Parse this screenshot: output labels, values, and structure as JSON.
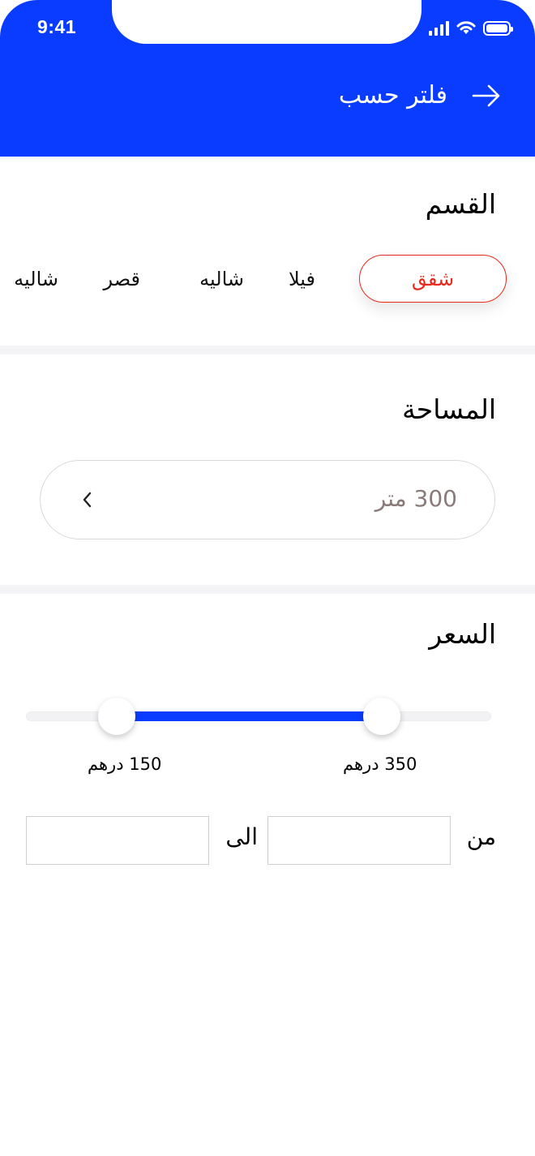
{
  "status_bar": {
    "time": "9:41"
  },
  "header": {
    "title": "فلتر حسب",
    "back_icon": "arrow-right-icon"
  },
  "colors": {
    "primary": "#0a3cff",
    "selected": "#e8291c"
  },
  "category": {
    "title": "القسم",
    "items": [
      {
        "label": "شقق",
        "selected": true
      },
      {
        "label": "فيلا",
        "selected": false
      },
      {
        "label": "شاليه",
        "selected": false
      },
      {
        "label": "قصر",
        "selected": false
      },
      {
        "label": "شاليه",
        "selected": false
      }
    ]
  },
  "area": {
    "title": "المساحة",
    "value": "300 متر",
    "icon": "chevron-left-icon"
  },
  "price": {
    "title": "السعر",
    "slider": {
      "max_label": "350 درهم",
      "min_label": "150 درهم"
    },
    "from_label": "من",
    "to_label": "الى",
    "from_value": "",
    "to_value": ""
  }
}
